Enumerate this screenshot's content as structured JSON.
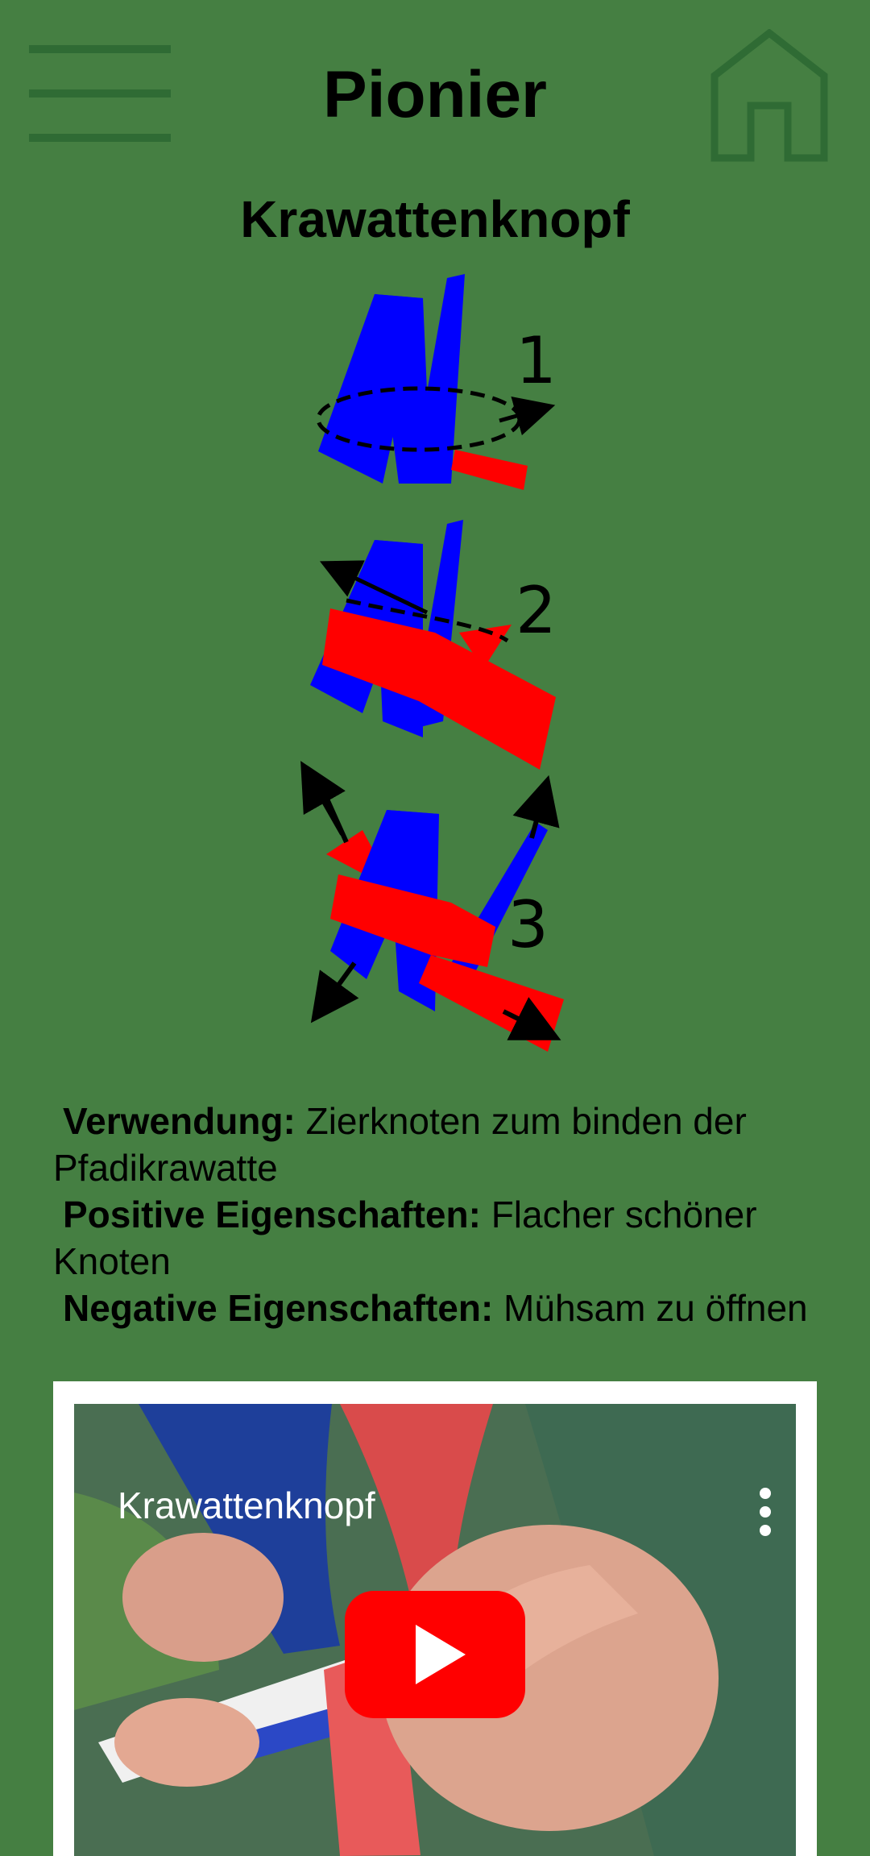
{
  "header": {
    "title": "Pionier",
    "menu_icon": "hamburger-menu-icon",
    "home_icon": "home-icon"
  },
  "knot": {
    "name": "Krawattenknopf",
    "diagram_steps": [
      "1",
      "2",
      "3"
    ],
    "diagram_colors": {
      "primary": "#0000ff",
      "secondary": "#ff0000",
      "arrows": "#000000"
    },
    "usage_label": "Verwendung:",
    "usage_text": "Zierknoten zum binden der Pfadikrawatte",
    "positive_label": "Positive Eigenschaften:",
    "positive_text": "Flacher schöner Knoten",
    "negative_label": "Negative Eigenschaften:",
    "negative_text": "Mühsam zu öffnen"
  },
  "video": {
    "title": "Krawattenknopf",
    "play_icon": "youtube-play-icon",
    "menu_icon": "more-vertical-icon"
  },
  "colors": {
    "background": "#457f42",
    "icon_dark_green": "#2f6b34",
    "youtube_red": "#ff0000"
  }
}
